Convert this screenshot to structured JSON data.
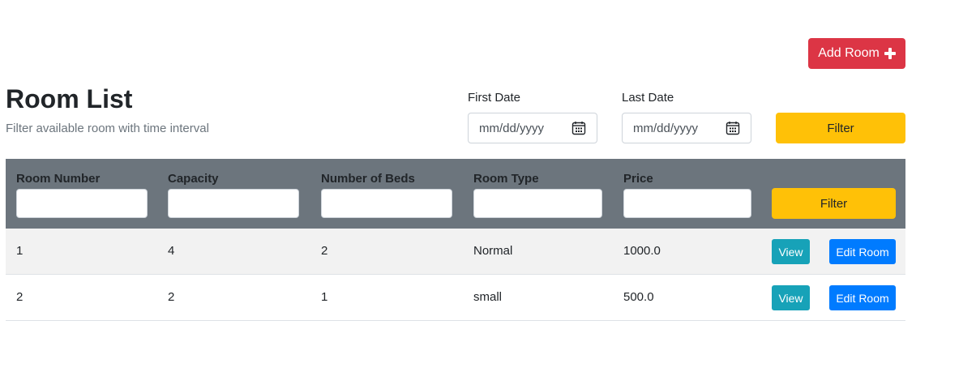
{
  "header": {
    "add_room_label": "Add Room",
    "title": "Room List",
    "subtitle": "Filter available room with time interval"
  },
  "date_filter": {
    "first_label": "First Date",
    "first_placeholder": "mm/dd/yyyy",
    "last_label": "Last Date",
    "last_placeholder": "mm/dd/yyyy",
    "filter_label": "Filter"
  },
  "table": {
    "columns": [
      "Room Number",
      "Capacity",
      "Number of Beds",
      "Room Type",
      "Price"
    ],
    "filter_label": "Filter",
    "view_label": "View",
    "edit_label": "Edit Room",
    "rows": [
      {
        "room_number": "1",
        "capacity": "4",
        "beds": "2",
        "type": "Normal",
        "price": "1000.0"
      },
      {
        "room_number": "2",
        "capacity": "2",
        "beds": "1",
        "type": "small",
        "price": "500.0"
      }
    ]
  },
  "colors": {
    "add_button": "#dc3545",
    "filter_button": "#ffc107",
    "table_header": "#6c757d",
    "view_button": "#17a2b8",
    "edit_button": "#007bff"
  }
}
